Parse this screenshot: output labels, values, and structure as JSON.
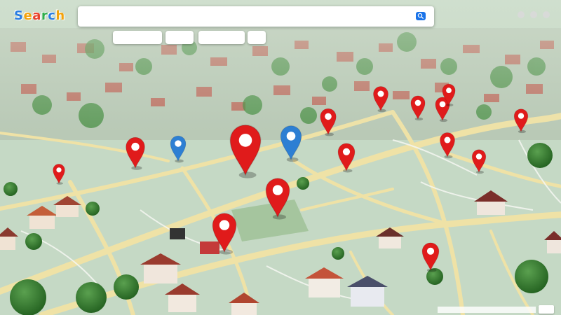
{
  "brand": {
    "letters": [
      "S",
      "e",
      "a",
      "r",
      "c",
      "h"
    ]
  },
  "search": {
    "value": "",
    "placeholder": ""
  },
  "chips": [
    {
      "label": ""
    },
    {
      "label": ""
    },
    {
      "label": ""
    },
    {
      "label": ""
    }
  ],
  "map_label": "",
  "attribution": "",
  "pins": {
    "red": 15,
    "blue": 2
  },
  "colors": {
    "pin_red": "#e01b1b",
    "pin_blue": "#2d7fd3",
    "road": "#efe2a6",
    "block": "#c2d6c3",
    "tree": "#2f7a33",
    "search_button": "#1a73e8"
  }
}
